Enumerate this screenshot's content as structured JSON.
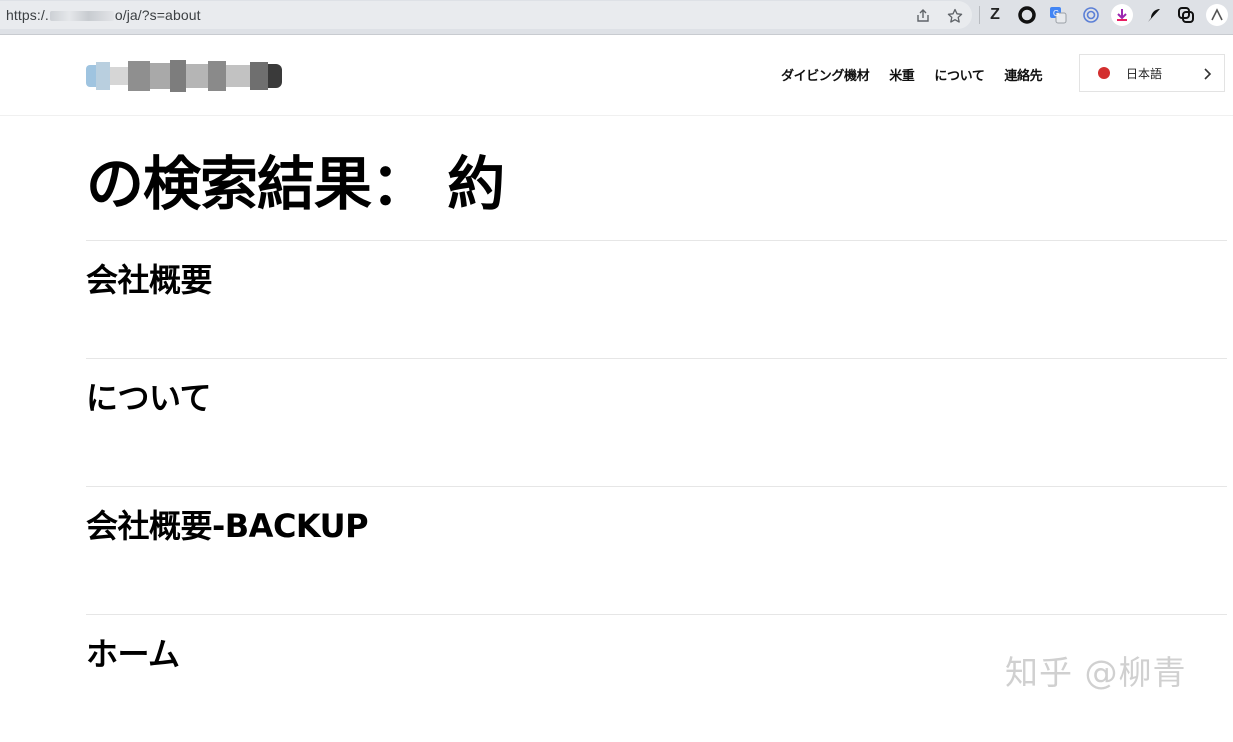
{
  "browser": {
    "url_prefix": "https:/.",
    "url_suffix": "o/ja/?s=about",
    "icons": [
      "share-icon",
      "star-icon",
      "zotero-icon",
      "circle-extension-icon",
      "translate-icon",
      "sync-icon",
      "downloader-icon",
      "feather-icon",
      "link-icon",
      "arc-icon"
    ],
    "ext_letter": "Z"
  },
  "header": {
    "nav": [
      "ダイビング機材",
      "米重",
      "について",
      "連絡先"
    ],
    "language": {
      "label": "日本語",
      "dot_color": "#d32f2f"
    }
  },
  "search": {
    "title": "の検索結果： 約"
  },
  "results": [
    {
      "title": "会社概要"
    },
    {
      "title": "について"
    },
    {
      "title": "会社概要-BACKUP"
    },
    {
      "title": "ホーム"
    }
  ],
  "watermark": "知乎 @柳青"
}
